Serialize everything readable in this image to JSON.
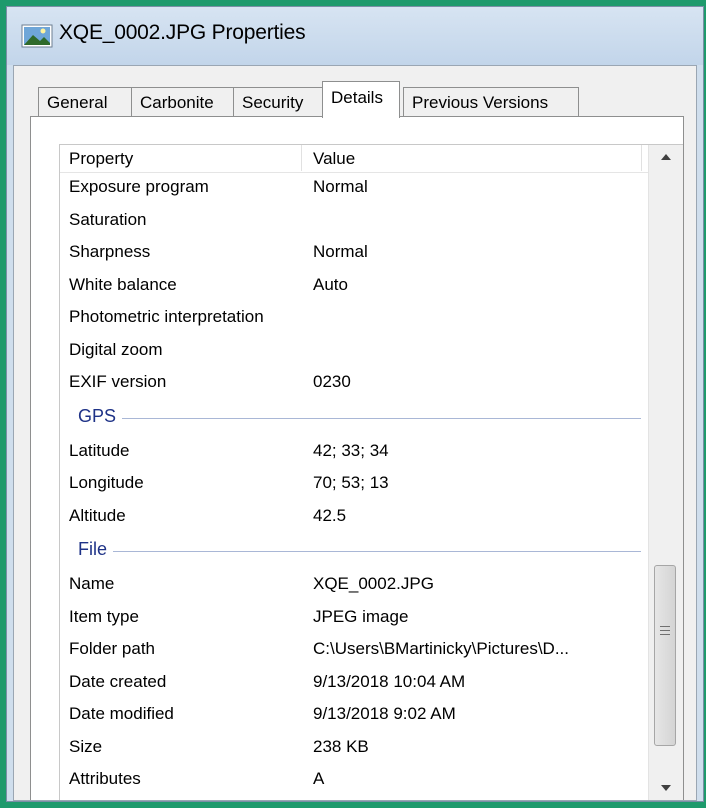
{
  "window": {
    "title": "XQE_0002.JPG Properties",
    "icon": "image-file-icon"
  },
  "tabs": [
    {
      "label": "General",
      "active": false
    },
    {
      "label": "Carbonite",
      "active": false
    },
    {
      "label": "Security",
      "active": false
    },
    {
      "label": "Details",
      "active": true
    },
    {
      "label": "Previous Versions",
      "active": false
    }
  ],
  "columns": {
    "property": "Property",
    "value": "Value"
  },
  "rows_top": [
    {
      "p": "Exposure program",
      "v": "Normal"
    },
    {
      "p": "Saturation",
      "v": ""
    },
    {
      "p": "Sharpness",
      "v": "Normal"
    },
    {
      "p": "White balance",
      "v": "Auto"
    },
    {
      "p": "Photometric interpretation",
      "v": ""
    },
    {
      "p": "Digital zoom",
      "v": ""
    },
    {
      "p": "EXIF version",
      "v": "0230"
    }
  ],
  "gps": {
    "label": "GPS",
    "rows": [
      {
        "p": "Latitude",
        "v": "42; 33; 34"
      },
      {
        "p": "Longitude",
        "v": "70; 53; 13"
      },
      {
        "p": "Altitude",
        "v": "42.5"
      }
    ]
  },
  "file": {
    "label": "File",
    "rows": [
      {
        "p": "Name",
        "v": "XQE_0002.JPG"
      },
      {
        "p": "Item type",
        "v": "JPEG image"
      },
      {
        "p": "Folder path",
        "v": "C:\\Users\\BMartinicky\\Pictures\\D..."
      },
      {
        "p": "Date created",
        "v": "9/13/2018 10:04 AM"
      },
      {
        "p": "Date modified",
        "v": "9/13/2018 9:02 AM"
      },
      {
        "p": "Size",
        "v": "238 KB"
      },
      {
        "p": "Attributes",
        "v": "A"
      }
    ]
  }
}
